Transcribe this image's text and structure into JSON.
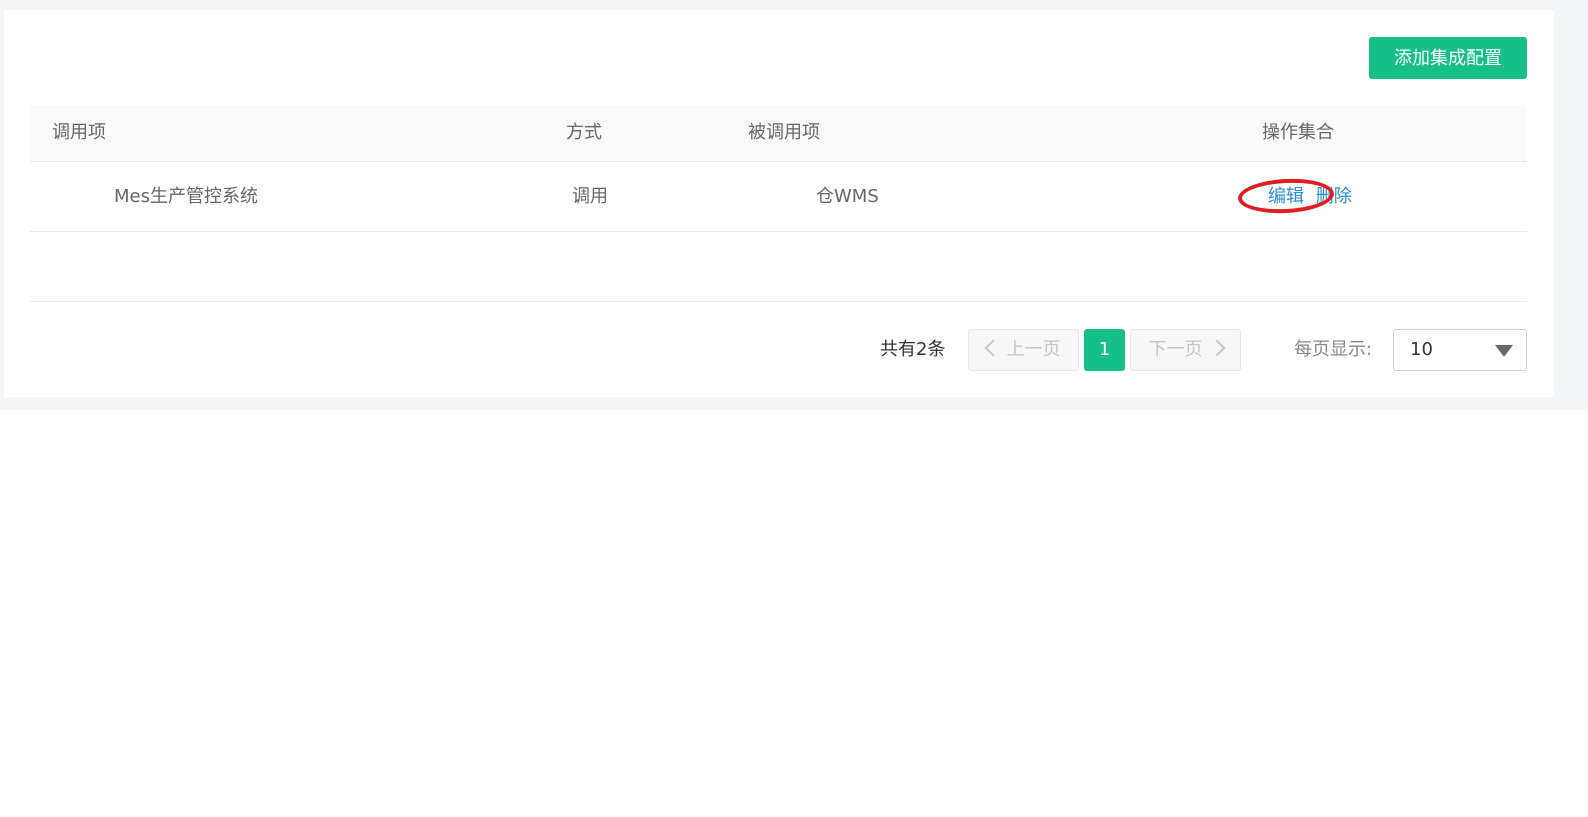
{
  "toolbar": {
    "add_label": "添加集成配置"
  },
  "table": {
    "headers": {
      "caller": "调用项",
      "method": "方式",
      "callee": "被调用项",
      "actions": "操作集合"
    },
    "rows": [
      {
        "caller": "Mes生产管控系统",
        "method": "调用",
        "callee": "仓WMS",
        "edit": "编辑",
        "delete": "删除"
      }
    ]
  },
  "pagination": {
    "total": "共有2条",
    "prev": "上一页",
    "current_page": "1",
    "next": "下一页",
    "per_page_label": "每页显示:",
    "per_page_value": "10"
  },
  "colors": {
    "accent": "#17bf88",
    "link": "#2d8ed8",
    "annotation": "#e01c24"
  }
}
